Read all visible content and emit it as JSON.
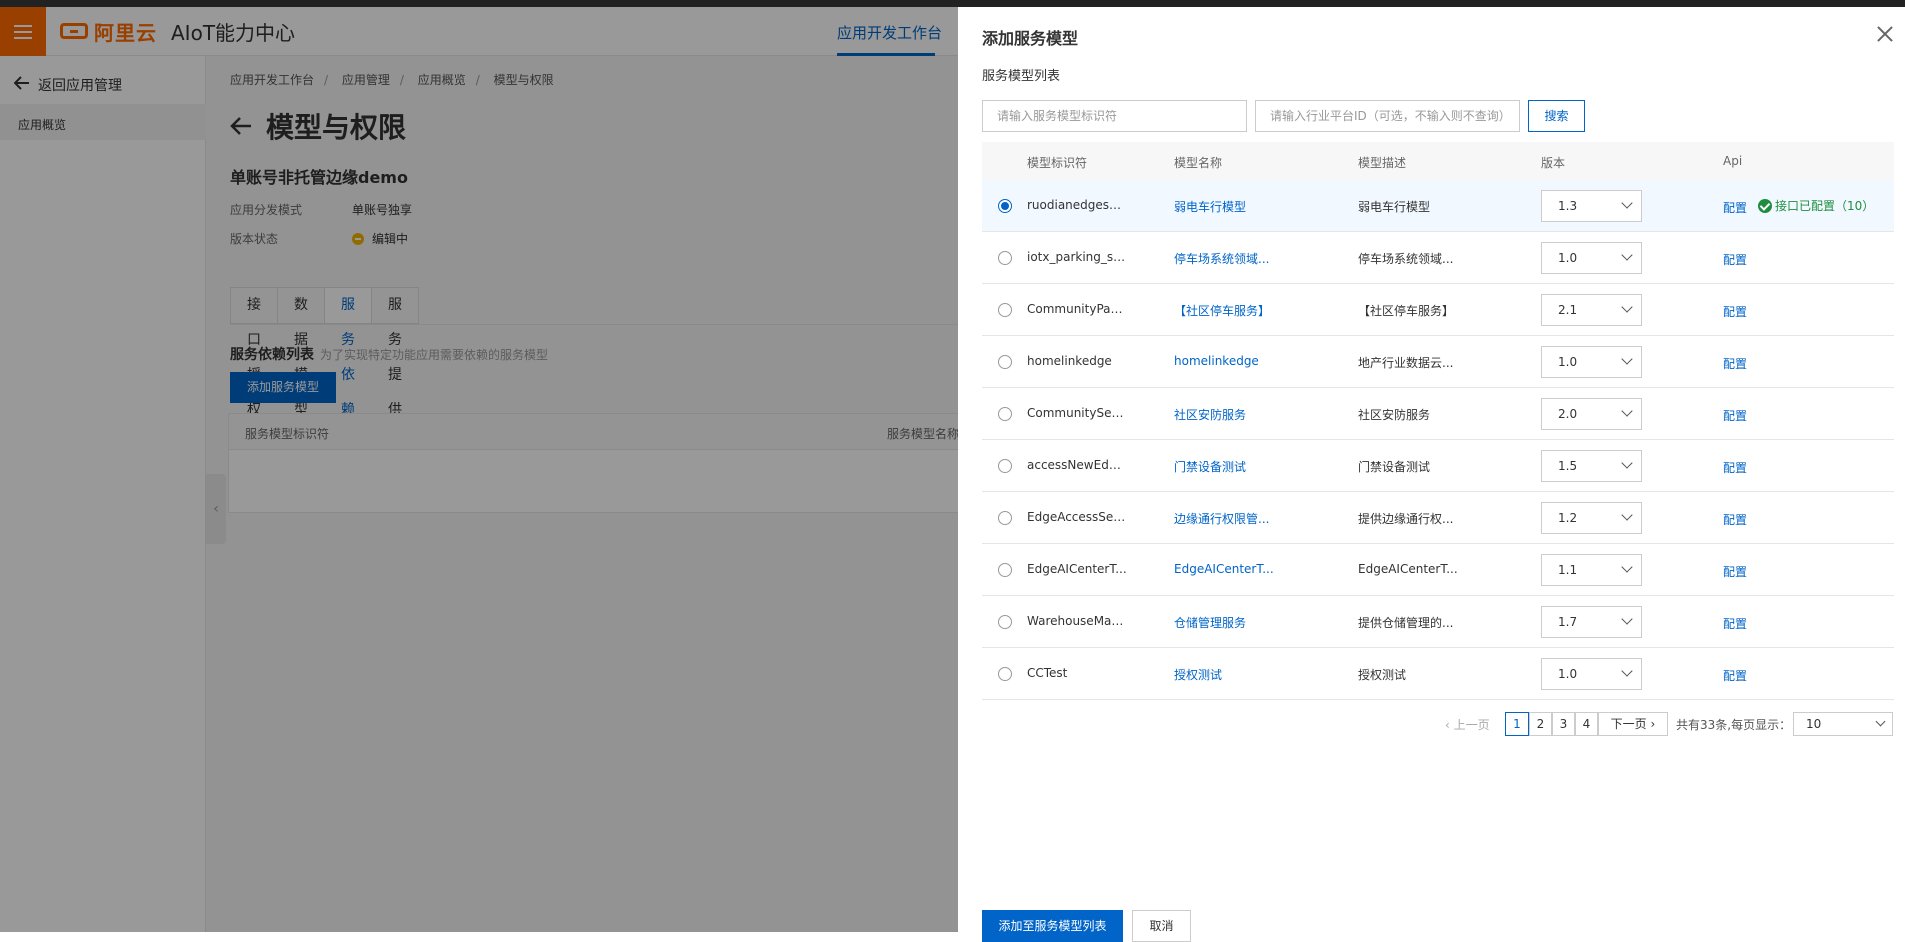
{
  "header": {
    "logo_text": "阿里云",
    "app_title": "AIoT能力中心",
    "nav_active": "应用开发工作台"
  },
  "sidebar": {
    "back_label": "返回应用管理",
    "items": [
      {
        "label": "应用概览"
      }
    ]
  },
  "breadcrumb": [
    "应用开发工作台",
    "应用管理",
    "应用概览",
    "模型与权限"
  ],
  "page": {
    "title": "模型与权限",
    "app_name": "单账号非托管边缘demo",
    "meta": [
      {
        "label": "应用分发模式",
        "value": "单账号独享"
      },
      {
        "label": "版本状态",
        "value": "编辑中"
      }
    ],
    "tabs": [
      "接口授权",
      "数据模型",
      "服务依赖",
      "服务提供"
    ],
    "active_tab": "服务依赖",
    "dep_title": "服务依赖列表",
    "dep_hint": "为了实现特定功能应用需要依赖的服务模型",
    "add_button": "添加服务模型",
    "dep_columns": [
      "服务模型标识符",
      "服务模型名称"
    ]
  },
  "drawer": {
    "title": "添加服务模型",
    "subtitle": "服务模型列表",
    "search_id_placeholder": "请输入服务模型标识符",
    "search_platform_placeholder": "请输入行业平台ID（可选，不输入则不查询）",
    "search_button": "搜索",
    "columns": [
      "模型标识符",
      "模型名称",
      "模型描述",
      "版本",
      "Api"
    ],
    "rows": [
      {
        "id": "ruodianedgeser...",
        "name": "弱电车行模型",
        "desc": "弱电车行模型",
        "version": "1.3",
        "config": "配置",
        "status": "接口已配置（10）",
        "selected": true
      },
      {
        "id": "iotx_parking_se...",
        "name": "停车场系统领域...",
        "desc": "停车场系统领域...",
        "version": "1.0",
        "config": "配置",
        "status": "",
        "selected": false
      },
      {
        "id": "CommunityPark...",
        "name": "【社区停车服务】",
        "desc": "【社区停车服务】",
        "version": "2.1",
        "config": "配置",
        "status": "",
        "selected": false
      },
      {
        "id": "homelinkedge",
        "name": "homelinkedge",
        "desc": "地产行业数据云...",
        "version": "1.0",
        "config": "配置",
        "status": "",
        "selected": false
      },
      {
        "id": "CommunitySec...",
        "name": "社区安防服务",
        "desc": "社区安防服务",
        "version": "2.0",
        "config": "配置",
        "status": "",
        "selected": false
      },
      {
        "id": "accessNewEdg...",
        "name": "门禁设备测试",
        "desc": "门禁设备测试",
        "version": "1.5",
        "config": "配置",
        "status": "",
        "selected": false
      },
      {
        "id": "EdgeAccessSer...",
        "name": "边缘通行权限管...",
        "desc": "提供边缘通行权...",
        "version": "1.2",
        "config": "配置",
        "status": "",
        "selected": false
      },
      {
        "id": "EdgeAICenterT...",
        "name": "EdgeAICenterT...",
        "desc": "EdgeAICenterT...",
        "version": "1.1",
        "config": "配置",
        "status": "",
        "selected": false
      },
      {
        "id": "WarehouseMan...",
        "name": "仓储管理服务",
        "desc": "提供仓储管理的...",
        "version": "1.7",
        "config": "配置",
        "status": "",
        "selected": false
      },
      {
        "id": "CCTest",
        "name": "授权测试",
        "desc": "授权测试",
        "version": "1.0",
        "config": "配置",
        "status": "",
        "selected": false
      }
    ],
    "pagination": {
      "prev": "上一页",
      "pages": [
        "1",
        "2",
        "3",
        "4"
      ],
      "current": "1",
      "next": "下一页",
      "total_text": "共有33条,每页显示：",
      "page_size": "10"
    },
    "footer": {
      "add_label": "添加至服务模型列表",
      "cancel_label": "取消"
    }
  },
  "colors": {
    "brand": "#ff6a00",
    "primary": "#0064c8",
    "success": "#1e8e3e",
    "warning": "#f1b400"
  }
}
